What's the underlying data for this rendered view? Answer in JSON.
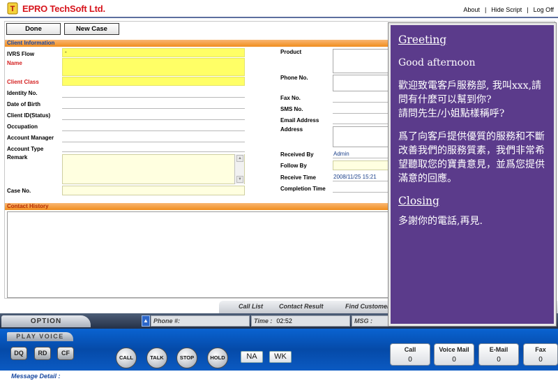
{
  "header": {
    "brand": "EPRO TechSoft Ltd.",
    "links": [
      "About",
      "Hide Script",
      "Log Off"
    ]
  },
  "toolbar": {
    "done_label": "Done",
    "new_case_label": "New Case"
  },
  "client_section": {
    "title": "Client Information",
    "left_labels": {
      "ivrs_flow": "IVRS Flow",
      "name": "Name",
      "client_class": "Client Class",
      "identity_no": "Identity No.",
      "dob": "Date of Birth",
      "client_id": "Client ID(Status)",
      "occupation": "Occupation",
      "account_manager": "Account Manager",
      "account_type": "Account Type",
      "remark": "Remark",
      "case_no": "Case No."
    },
    "ivrs_flow_value": "-",
    "right_labels": {
      "product": "Product",
      "phone_no": "Phone No.",
      "fax_no": "Fax No.",
      "sms_no": "SMS No.",
      "email": "Email Address",
      "address": "Address",
      "received_by": "Received By",
      "follow_by": "Follow By",
      "receive_time": "Receive Time",
      "completion_time": "Completion Time"
    },
    "received_by_value": "Admin",
    "receive_time_value": "2008/11/25 15:21"
  },
  "history_section": {
    "title": "Contact History"
  },
  "script_panel": {
    "greeting_heading": "Greeting",
    "greeting_text": "Good afternoon",
    "greeting_zh_1": "歡迎致電客戶服務部, 我叫xxx,請問有什麼可以幫到你?",
    "greeting_zh_2": "請問先生/小姐點樣稱呼?",
    "service_zh": "爲了向客戶提供優質的服務和不斷改善我們的服務質素，我們非常希望聽取您的寶貴意見，並爲您提供滿意的回應。",
    "closing_heading": "Closing",
    "closing_text": "多謝你的電話,再見."
  },
  "bottom_tabs": [
    "Call List",
    "Contact Result",
    "Find Customer"
  ],
  "status": {
    "option_label": "OPTION",
    "phone_label": "Phone #:",
    "time_label": "Time :",
    "time_value": "02:52",
    "msg_label": "MSG :"
  },
  "controls": {
    "play_voice_label": "PLAY VOICE",
    "dq": "DQ",
    "rd": "RD",
    "cf": "CF",
    "call": "CALL",
    "talk": "TALK",
    "stop": "STOP",
    "hold": "HOLD",
    "na": "NA",
    "wk": "WK"
  },
  "counters": [
    {
      "label": "Call",
      "value": "0"
    },
    {
      "label": "Voice Mail",
      "value": "0"
    },
    {
      "label": "E-Mail",
      "value": "0"
    },
    {
      "label": "Fax",
      "value": "0"
    }
  ],
  "message_detail_label": "Message Detail :",
  "colors": {
    "brand": "#d7141c",
    "script_bg": "#5b3b8b",
    "section_orange": "#f08d1e",
    "field_yellow": "#ffff66",
    "toolbar_blue": "#054aa8"
  }
}
